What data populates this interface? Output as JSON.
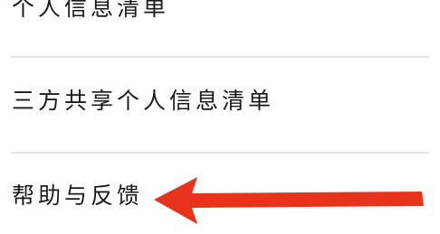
{
  "menu": {
    "items": [
      {
        "label": "个人信息清单"
      },
      {
        "label": "三方共享个人信息清单"
      },
      {
        "label": "帮助与反馈"
      }
    ]
  },
  "annotation": {
    "arrow_color": "#e8331c",
    "arrow_target": "帮助与反馈"
  }
}
